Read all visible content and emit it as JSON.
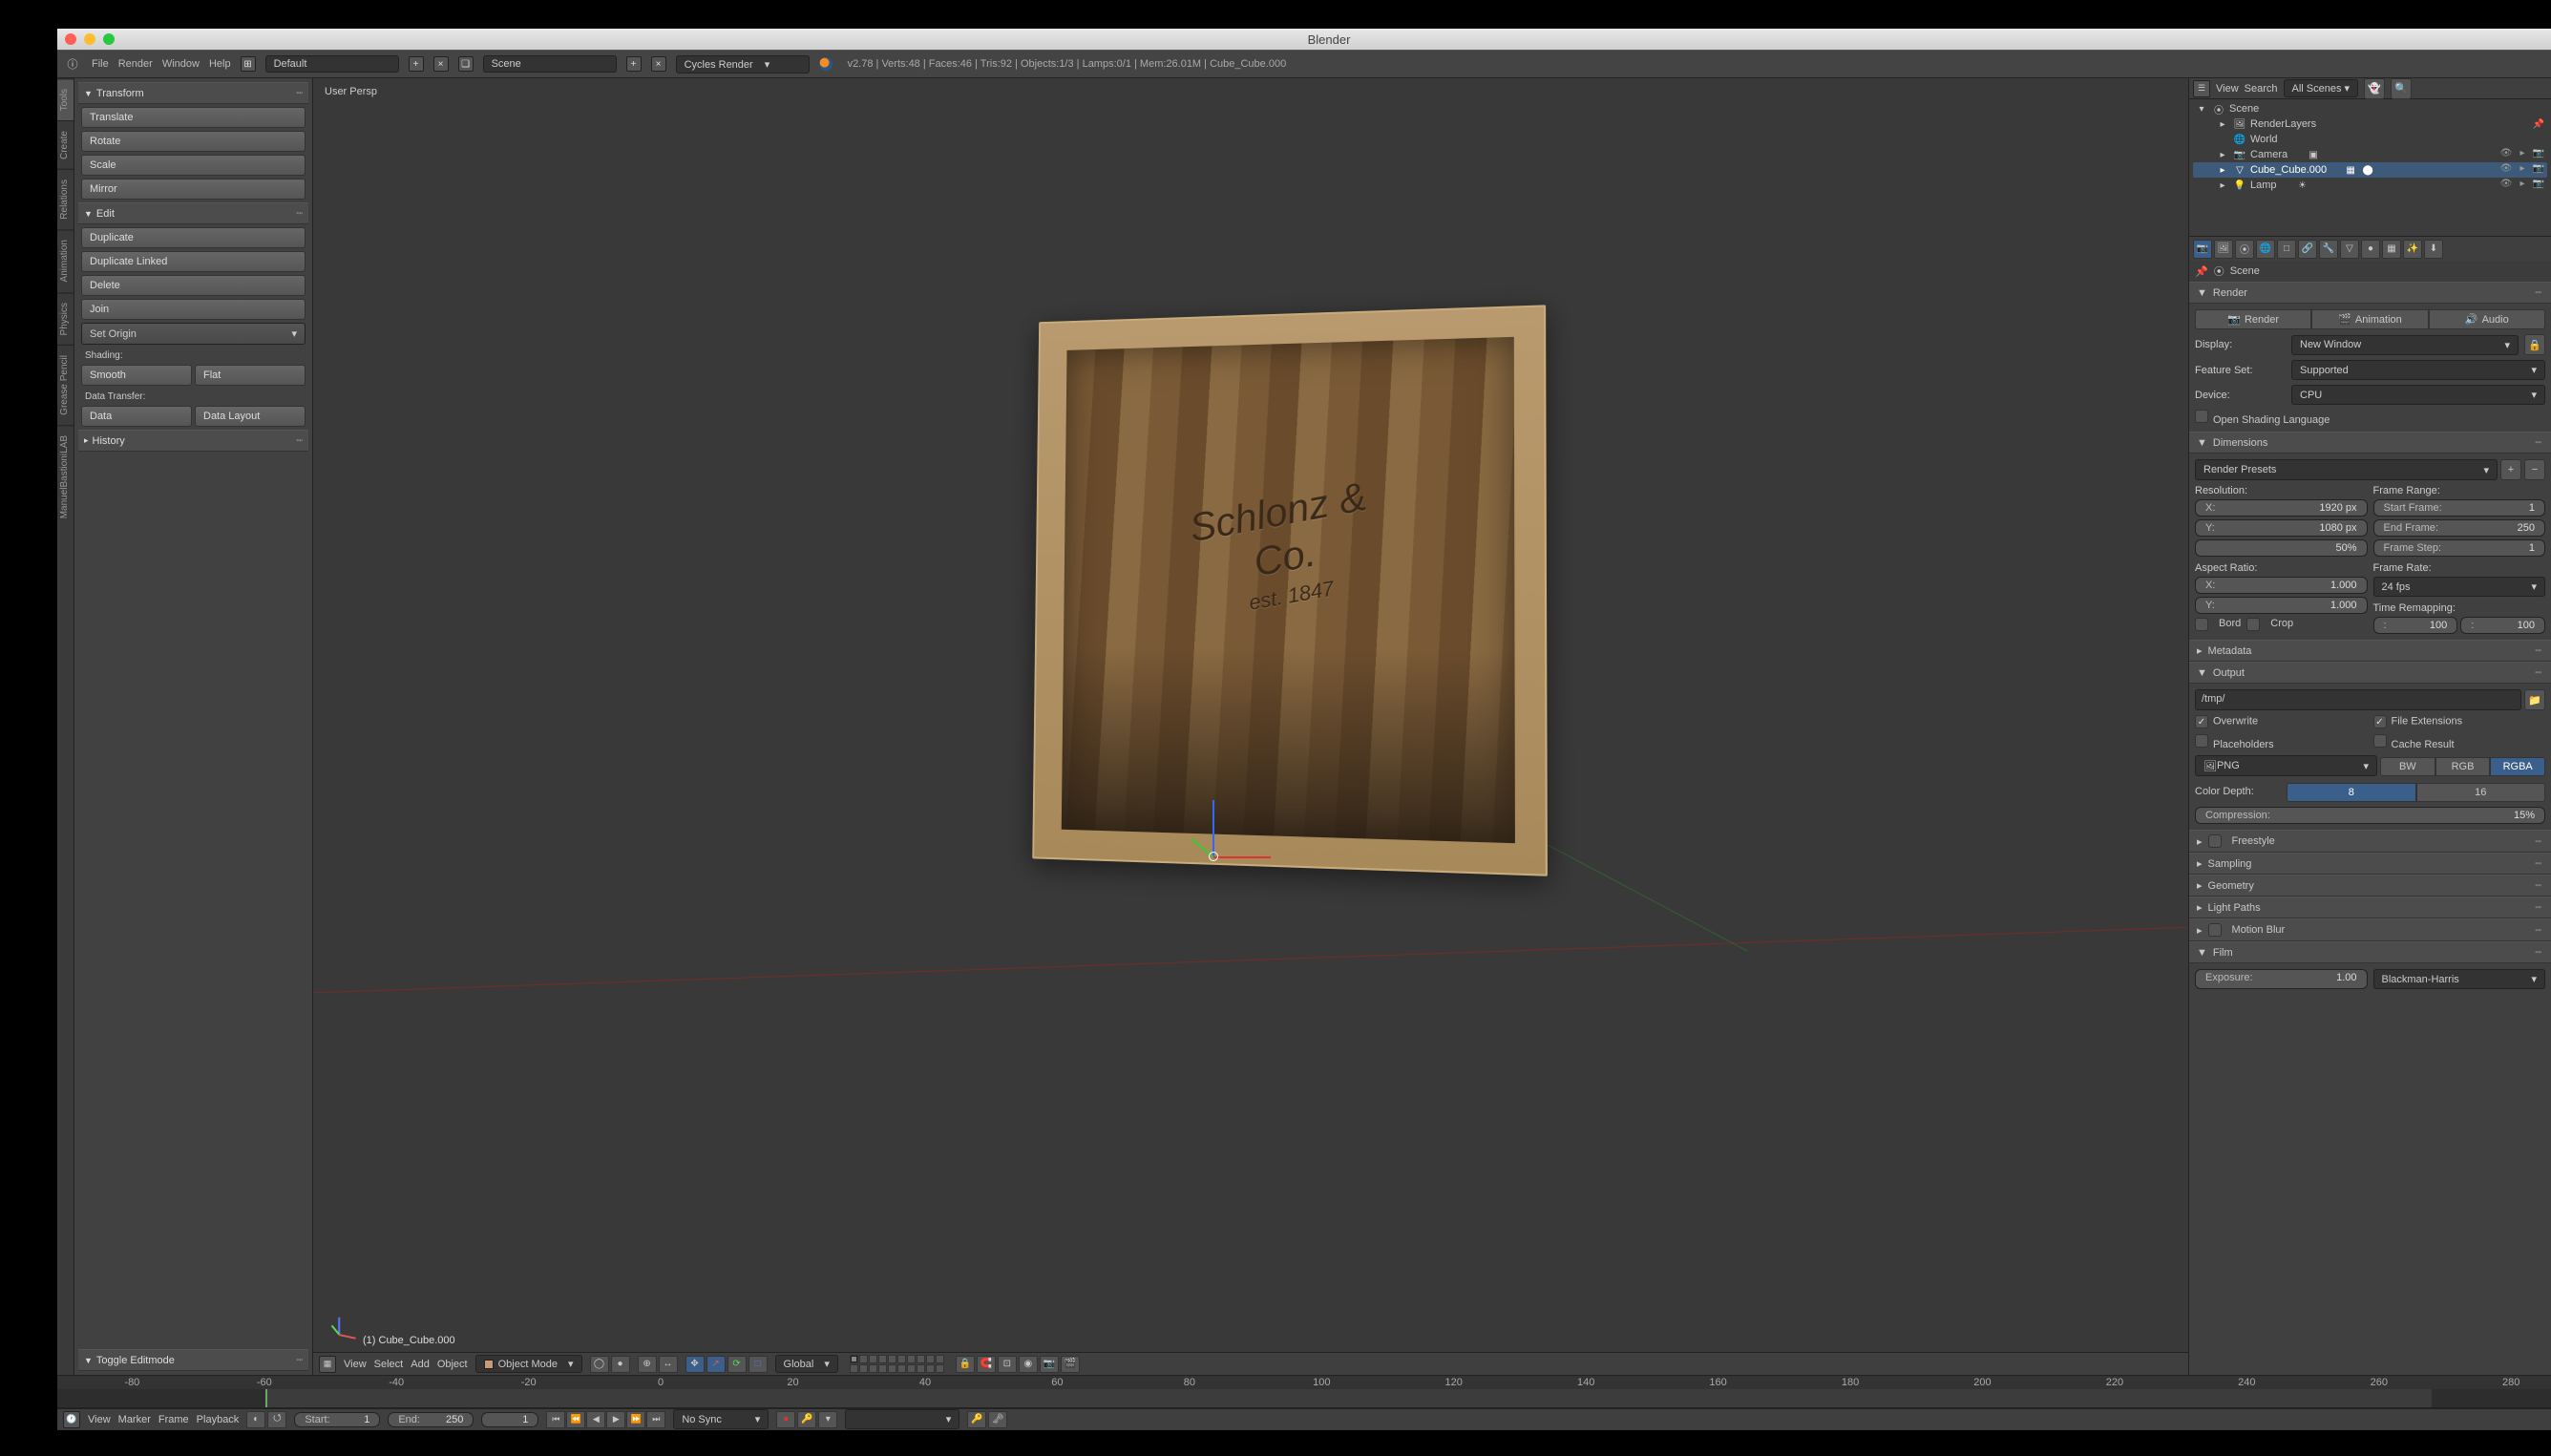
{
  "window": {
    "title": "Blender"
  },
  "menubar": {
    "menus": [
      "File",
      "Render",
      "Window",
      "Help"
    ],
    "layout": "Default",
    "scene": "Scene",
    "engine": "Cycles Render",
    "stats": "v2.78 | Verts:48 | Faces:46 | Tris:92 | Objects:1/3 | Lamps:0/1 | Mem:26.01M | Cube_Cube.000"
  },
  "left_tabs": [
    "Tools",
    "Create",
    "Relations",
    "Animation",
    "Physics",
    "Grease Pencil",
    "ManuelBastioniLAB"
  ],
  "toolshelf": {
    "transform": {
      "title": "Transform",
      "translate": "Translate",
      "rotate": "Rotate",
      "scale": "Scale",
      "mirror": "Mirror"
    },
    "edit": {
      "title": "Edit",
      "duplicate": "Duplicate",
      "duplicate_linked": "Duplicate Linked",
      "delete": "Delete",
      "join": "Join",
      "set_origin": "Set Origin"
    },
    "shading": {
      "label": "Shading:",
      "smooth": "Smooth",
      "flat": "Flat"
    },
    "datatransfer": {
      "label": "Data Transfer:",
      "data": "Data",
      "data_layout": "Data Layout"
    },
    "history": "History",
    "ops_panel": "Toggle Editmode"
  },
  "viewport": {
    "persp": "User Persp",
    "object_label": "(1) Cube_Cube.000",
    "crate": {
      "line1": "Schlonz & Co.",
      "line2": "est. 1847"
    },
    "header": {
      "menus": [
        "View",
        "Select",
        "Add",
        "Object"
      ],
      "mode": "Object Mode",
      "orientation": "Global"
    }
  },
  "timeline": {
    "ticks": [
      "-80",
      "-60",
      "-40",
      "-20",
      "0",
      "20",
      "40",
      "60",
      "80",
      "100",
      "120",
      "140",
      "160",
      "180",
      "200",
      "220",
      "240",
      "260",
      "280"
    ],
    "menus": [
      "View",
      "Marker",
      "Frame",
      "Playback"
    ],
    "start_label": "Start:",
    "start": "1",
    "end_label": "End:",
    "end": "250",
    "cur": "1",
    "sync": "No Sync"
  },
  "outliner": {
    "search_ph": "Search",
    "filter": "All Scenes",
    "scene": "Scene",
    "renderlayers": "RenderLayers",
    "world": "World",
    "camera": "Camera",
    "cube": "Cube_Cube.000",
    "lamp": "Lamp"
  },
  "crumb": {
    "scene": "Scene"
  },
  "render_panel": {
    "title": "Render",
    "render_btn": "Render",
    "anim_btn": "Animation",
    "audio_btn": "Audio",
    "display_label": "Display:",
    "display": "New Window",
    "feature_label": "Feature Set:",
    "feature": "Supported",
    "device_label": "Device:",
    "device": "CPU",
    "osl": "Open Shading Language"
  },
  "dimensions": {
    "title": "Dimensions",
    "presets": "Render Presets",
    "res_label": "Resolution:",
    "x": "1920 px",
    "y": "1080 px",
    "pct": "50%",
    "aspect_label": "Aspect Ratio:",
    "ax": "1.000",
    "ay": "1.000",
    "border": "Bord",
    "crop": "Crop",
    "fr_label": "Frame Range:",
    "sf": "Start Frame:",
    "sf_v": "1",
    "ef": "End Frame:",
    "ef_v": "250",
    "fs": "Frame Step:",
    "fs_v": "1",
    "rate_label": "Frame Rate:",
    "rate": "24 fps",
    "remap": "Time Remapping:",
    "r1": "100",
    "r2": "100"
  },
  "metadata": "Metadata",
  "output": {
    "title": "Output",
    "path": "/tmp/",
    "overwrite": "Overwrite",
    "file_ext": "File Extensions",
    "placeholders": "Placeholders",
    "cache": "Cache Result",
    "format": "PNG",
    "bw": "BW",
    "rgb": "RGB",
    "rgba": "RGBA",
    "depth_label": "Color Depth:",
    "d8": "8",
    "d16": "16",
    "comp_label": "Compression:",
    "comp": "15%"
  },
  "more_panels": {
    "freestyle": "Freestyle",
    "sampling": "Sampling",
    "geometry": "Geometry",
    "lightpaths": "Light Paths",
    "motionblur": "Motion Blur",
    "film": "Film",
    "exposure_label": "Exposure:",
    "exposure": "1.00",
    "filter": "Blackman-Harris"
  }
}
